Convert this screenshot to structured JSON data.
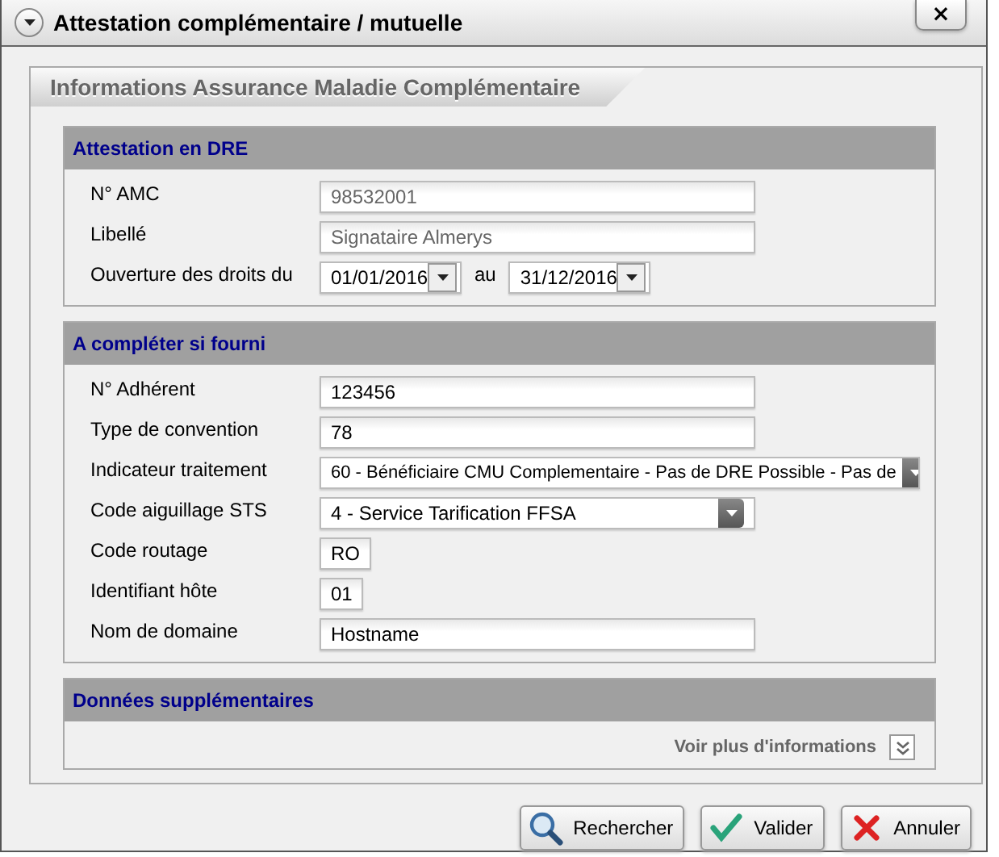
{
  "window": {
    "title": "Attestation complémentaire / mutuelle",
    "close": "×"
  },
  "panel": {
    "title": "Informations Assurance Maladie Complémentaire"
  },
  "sections": [
    {
      "title": "Attestation en DRE",
      "rows": [
        {
          "kind": "text",
          "label": "N° AMC",
          "value": "98532001",
          "disabled": true
        },
        {
          "kind": "text",
          "label": "Libellé",
          "value": "Signataire Almerys",
          "disabled": true
        },
        {
          "kind": "date-range",
          "label": "Ouverture des droits du",
          "from": "01/01/2016",
          "separator": "au",
          "to": "31/12/2016"
        }
      ]
    },
    {
      "title": "A compléter si fourni",
      "rows": [
        {
          "kind": "text",
          "label": "N° Adhérent",
          "value": "123456",
          "disabled": false
        },
        {
          "kind": "text",
          "label": "Type de convention",
          "value": "78",
          "disabled": false
        },
        {
          "kind": "select-wide",
          "label": "Indicateur traitement",
          "value": "60 - Bénéficiaire CMU Complementaire - Pas de DRE Possible - Pas de"
        },
        {
          "kind": "select",
          "label": "Code aiguillage STS",
          "value": "4 - Service Tarification FFSA"
        },
        {
          "kind": "text-short",
          "label": "Code routage",
          "value": "RO",
          "disabled": false
        },
        {
          "kind": "text-short",
          "label": "Identifiant hôte",
          "value": "01",
          "disabled": false
        },
        {
          "kind": "text",
          "label": "Nom de domaine",
          "value": "Hostname",
          "disabled": false
        }
      ]
    },
    {
      "title": "Données supplémentaires",
      "more": "Voir plus d'informations"
    }
  ],
  "buttons": [
    {
      "kind": "search",
      "label": "Rechercher"
    },
    {
      "kind": "ok",
      "label": "Valider"
    },
    {
      "kind": "cancel",
      "label": "Annuler"
    }
  ]
}
